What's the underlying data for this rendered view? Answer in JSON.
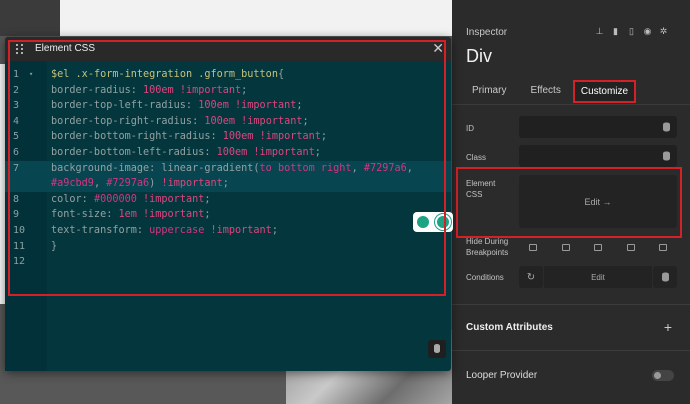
{
  "inspector": {
    "title": "Inspector",
    "element_name": "Div",
    "tools": [
      "pin-icon",
      "copy-icon",
      "trash-icon",
      "eye-icon",
      "settings-icon"
    ],
    "tabs": [
      {
        "label": "Primary",
        "active": false
      },
      {
        "label": "Effects",
        "active": false
      },
      {
        "label": "Customize",
        "active": true
      }
    ],
    "fields": {
      "id_label": "ID",
      "class_label": "Class",
      "element_css_label": "Element CSS",
      "element_css_button": "Edit →",
      "hide_label": "Hide During Breakpoints",
      "conditions_label": "Conditions",
      "conditions_button": "Edit"
    },
    "sections": {
      "custom_attributes": "Custom Attributes",
      "looper_provider": "Looper Provider"
    },
    "accent_color": "#d32127"
  },
  "modal": {
    "title": "Element CSS",
    "lines": [
      {
        "n": "1",
        "fold": "▾",
        "parts": [
          [
            "kw",
            "$el "
          ],
          [
            "sel",
            ".x-form-integration .gform_button"
          ],
          [
            "plain",
            "{"
          ]
        ]
      },
      {
        "n": "2",
        "parts": [
          [
            "plain",
            "border-radius: "
          ],
          [
            "num",
            "100em"
          ],
          [
            "plain",
            " "
          ],
          [
            "imp",
            "!important"
          ],
          [
            "plain",
            ";"
          ]
        ]
      },
      {
        "n": "3",
        "parts": [
          [
            "plain",
            "border-top-left-radius: "
          ],
          [
            "num",
            "100em"
          ],
          [
            "plain",
            " "
          ],
          [
            "imp",
            "!important"
          ],
          [
            "plain",
            ";"
          ]
        ]
      },
      {
        "n": "4",
        "parts": [
          [
            "plain",
            "border-top-right-radius: "
          ],
          [
            "num",
            "100em"
          ],
          [
            "plain",
            " "
          ],
          [
            "imp",
            "!important"
          ],
          [
            "plain",
            ";"
          ]
        ]
      },
      {
        "n": "5",
        "parts": [
          [
            "plain",
            "border-bottom-right-radius: "
          ],
          [
            "num",
            "100em"
          ],
          [
            "plain",
            " "
          ],
          [
            "imp",
            "!important"
          ],
          [
            "plain",
            ";"
          ]
        ]
      },
      {
        "n": "6",
        "parts": [
          [
            "plain",
            "border-bottom-left-radius: "
          ],
          [
            "num",
            "100em"
          ],
          [
            "plain",
            " "
          ],
          [
            "imp",
            "!important"
          ],
          [
            "plain",
            ";"
          ]
        ]
      },
      {
        "n": "7",
        "tall": true,
        "active": true,
        "parts": [
          [
            "plain",
            "background-image: linear-gradient("
          ],
          [
            "val",
            "to bottom right"
          ],
          [
            "plain",
            ", "
          ],
          [
            "val",
            "#7297a6"
          ],
          [
            "plain",
            ",\n"
          ],
          [
            "val",
            "#a9cbd9"
          ],
          [
            "plain",
            ", "
          ],
          [
            "val",
            "#7297a6"
          ],
          [
            "plain",
            ") "
          ],
          [
            "imp",
            "!important"
          ],
          [
            "plain",
            ";"
          ]
        ]
      },
      {
        "n": "8",
        "parts": [
          [
            "plain",
            "color: "
          ],
          [
            "val",
            "#000000"
          ],
          [
            "plain",
            " "
          ],
          [
            "imp",
            "!important"
          ],
          [
            "plain",
            ";"
          ]
        ]
      },
      {
        "n": "9",
        "parts": [
          [
            "plain",
            "font-size: "
          ],
          [
            "num",
            "1em"
          ],
          [
            "plain",
            " "
          ],
          [
            "imp",
            "!important"
          ],
          [
            "plain",
            ";"
          ]
        ]
      },
      {
        "n": "10",
        "parts": [
          [
            "plain",
            "text-transform: "
          ],
          [
            "val",
            "uppercase"
          ],
          [
            "plain",
            " "
          ],
          [
            "imp",
            "!important"
          ],
          [
            "plain",
            ";"
          ]
        ]
      },
      {
        "n": "11",
        "parts": [
          [
            "plain",
            "}"
          ]
        ]
      },
      {
        "n": "12",
        "parts": []
      }
    ]
  }
}
